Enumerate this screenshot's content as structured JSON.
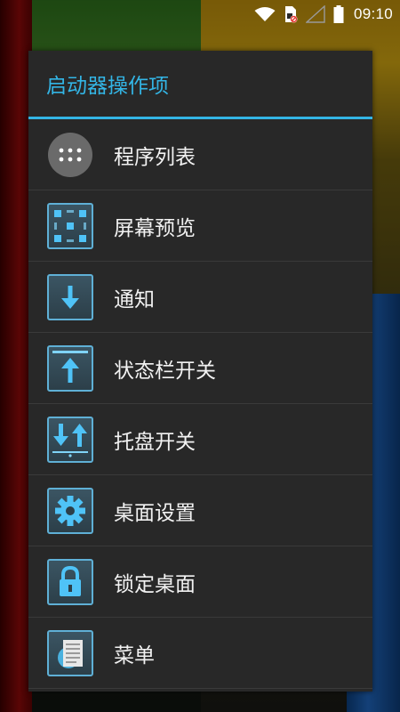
{
  "status_bar": {
    "time": "09:10",
    "icons": [
      "wifi-icon",
      "sim-no-service-icon",
      "signal-empty-icon",
      "battery-full-icon"
    ]
  },
  "dialog": {
    "title": "启动器操作项",
    "accent_color": "#33b5e5",
    "items": [
      {
        "label": "程序列表",
        "icon": "app-drawer-icon"
      },
      {
        "label": "屏幕预览",
        "icon": "screen-preview-icon"
      },
      {
        "label": "通知",
        "icon": "notification-down-arrow-icon"
      },
      {
        "label": "状态栏开关",
        "icon": "statusbar-up-arrow-icon"
      },
      {
        "label": "托盘开关",
        "icon": "tray-toggle-icon"
      },
      {
        "label": "桌面设置",
        "icon": "gear-icon"
      },
      {
        "label": "锁定桌面",
        "icon": "lock-icon"
      },
      {
        "label": "菜单",
        "icon": "menu-document-icon"
      }
    ]
  }
}
